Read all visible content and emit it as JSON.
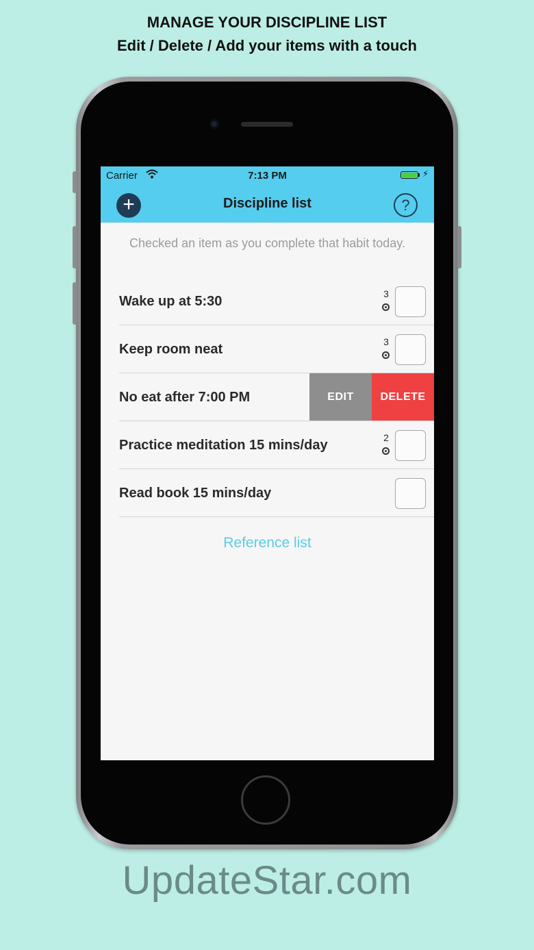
{
  "promo": {
    "headline": "MANAGE YOUR DISCIPLINE LIST",
    "subheadline": "Edit / Delete / Add your items with a touch"
  },
  "status_bar": {
    "carrier": "Carrier",
    "time": "7:13 PM",
    "wifi_icon": "wifi-icon",
    "battery_icon": "battery-icon",
    "battery_level_percent": 100,
    "charging_icon": "charging-bolt-icon",
    "bolt_glyph": "⚡"
  },
  "nav": {
    "add_glyph": "+",
    "title": "Discipline list",
    "help_glyph": "?"
  },
  "instructions": "Checked an item as you complete that habit today.",
  "items": [
    {
      "label": "Wake up at 5:30",
      "streak": "3",
      "checked": false
    },
    {
      "label": "Keep room neat",
      "streak": "3",
      "checked": false
    },
    {
      "label": "No eat after 7:00 PM",
      "swiped": true
    },
    {
      "label": "Practice meditation 15 mins/day",
      "streak": "2",
      "checked": false
    },
    {
      "label": "Read book 15 mins/day",
      "checked": false
    }
  ],
  "swipe_actions": {
    "edit_label": "EDIT",
    "delete_label": "DELETE"
  },
  "reference_link": "Reference list",
  "watermark": "UpdateStar.com",
  "colors": {
    "background": "#bdeee5",
    "nav_bar": "#55cdee",
    "add_button": "#1f3c55",
    "edit_action": "#8e8e8e",
    "delete_action": "#ef4141",
    "link": "#5ccbe6",
    "battery": "#4ccf3c"
  }
}
